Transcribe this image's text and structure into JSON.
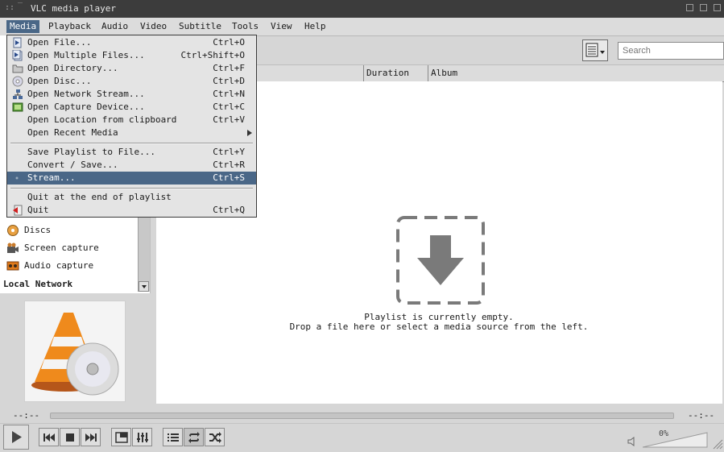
{
  "window": {
    "title": "VLC media player"
  },
  "menubar": [
    "Media",
    "Playback",
    "Audio",
    "Video",
    "Subtitle",
    "Tools",
    "View",
    "Help"
  ],
  "search": {
    "placeholder": "Search"
  },
  "playlist": {
    "columns": [
      "Duration",
      "Album"
    ],
    "empty_line1": "Playlist is currently empty.",
    "empty_line2": "Drop a file here or select a media source from the left."
  },
  "sidebar": {
    "items": [
      {
        "label": "Discs",
        "icon": "disc-icon"
      },
      {
        "label": "Screen capture",
        "icon": "camera-icon"
      },
      {
        "label": "Audio capture",
        "icon": "audio-capture-icon"
      }
    ],
    "section_local_network": "Local Network"
  },
  "media_menu": {
    "items": [
      {
        "label": "Open File...",
        "shortcut": "Ctrl+O",
        "icon": "file-icon"
      },
      {
        "label": "Open Multiple Files...",
        "shortcut": "Ctrl+Shift+O",
        "icon": "files-icon"
      },
      {
        "label": "Open Directory...",
        "shortcut": "Ctrl+F",
        "icon": "folder-icon"
      },
      {
        "label": "Open Disc...",
        "shortcut": "Ctrl+D",
        "icon": "disc-icon"
      },
      {
        "label": "Open Network Stream...",
        "shortcut": "Ctrl+N",
        "icon": "network-icon"
      },
      {
        "label": "Open Capture Device...",
        "shortcut": "Ctrl+C",
        "icon": "capture-icon"
      },
      {
        "label": "Open Location from clipboard",
        "shortcut": "Ctrl+V",
        "icon": ""
      },
      {
        "label": "Open Recent Media",
        "shortcut": "",
        "icon": ""
      },
      {
        "label": "Save Playlist to File...",
        "shortcut": "Ctrl+Y",
        "icon": ""
      },
      {
        "label": "Convert / Save...",
        "shortcut": "Ctrl+R",
        "icon": ""
      },
      {
        "label": "Stream...",
        "shortcut": "Ctrl+S",
        "icon": "stream-icon"
      },
      {
        "label": "Quit at the end of playlist",
        "shortcut": "",
        "icon": ""
      },
      {
        "label": "Quit",
        "shortcut": "Ctrl+Q",
        "icon": "quit-icon"
      }
    ]
  },
  "seek": {
    "elapsed": "--:--",
    "total": "--:--",
    "progress": 0
  },
  "volume": {
    "label": "0%",
    "value": 0
  },
  "colors": {
    "accent": "#4a6787",
    "titlebar": "#3c3c3c"
  }
}
